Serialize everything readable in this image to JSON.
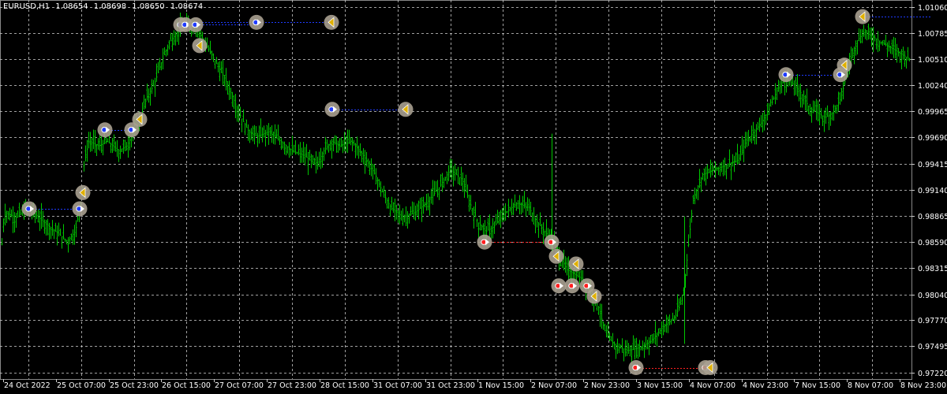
{
  "chart_data": {
    "type": "candlestick",
    "symbol": "EURUSD,H1",
    "ohlc": [
      "1.08654",
      "1.08698",
      "1.08650",
      "1.08674"
    ],
    "y_ticks": [
      "1.01060",
      "1.00785",
      "1.00510",
      "1.00240",
      "0.99965",
      "0.99690",
      "0.99415",
      "0.99140",
      "0.98865",
      "0.98590",
      "0.98315",
      "0.98040",
      "0.97770",
      "0.97495",
      "0.97220"
    ],
    "y_tick_values": [
      1.0106,
      1.00785,
      1.0051,
      1.0024,
      0.99965,
      0.9969,
      0.99415,
      0.9914,
      0.98865,
      0.9859,
      0.98315,
      0.9804,
      0.9777,
      0.97495,
      0.9722
    ],
    "x_ticks": [
      "24 Oct 2022",
      "25 Oct 07:00",
      "25 Oct 23:00",
      "26 Oct 15:00",
      "27 Oct 07:00",
      "27 Oct 23:00",
      "28 Oct 15:00",
      "31 Oct 07:00",
      "31 Oct 23:00",
      "1 Nov 15:00",
      "2 Nov 07:00",
      "2 Nov 23:00",
      "3 Nov 15:00",
      "4 Nov 07:00",
      "4 Nov 23:00",
      "7 Nov 15:00",
      "8 Nov 07:00",
      "8 Nov 23:00"
    ],
    "ylim": [
      0.9715,
      1.01135
    ],
    "grid": true,
    "close_path": [
      [
        0,
        0.9835
      ],
      [
        5,
        0.989
      ],
      [
        20,
        0.9885
      ],
      [
        35,
        0.9895
      ],
      [
        55,
        0.988
      ],
      [
        70,
        0.987
      ],
      [
        85,
        0.986
      ],
      [
        95,
        0.987
      ],
      [
        103,
        0.9905
      ],
      [
        106,
        0.994
      ],
      [
        112,
        0.9965
      ],
      [
        125,
        0.996
      ],
      [
        135,
        0.9965
      ],
      [
        150,
        0.9955
      ],
      [
        160,
        0.996
      ],
      [
        170,
        0.9975
      ],
      [
        178,
        0.999
      ],
      [
        185,
        1.001
      ],
      [
        195,
        1.0025
      ],
      [
        205,
        1.005
      ],
      [
        215,
        1.007
      ],
      [
        230,
        1.0085
      ],
      [
        245,
        1.0088
      ],
      [
        255,
        1.0075
      ],
      [
        265,
        1.006
      ],
      [
        275,
        1.0045
      ],
      [
        285,
        1.003
      ],
      [
        295,
        1.001
      ],
      [
        305,
        0.999
      ],
      [
        315,
        0.9975
      ],
      [
        325,
        0.997
      ],
      [
        340,
        0.9975
      ],
      [
        355,
        0.9965
      ],
      [
        370,
        0.9955
      ],
      [
        385,
        0.995
      ],
      [
        400,
        0.994
      ],
      [
        410,
        0.9955
      ],
      [
        420,
        0.9965
      ],
      [
        430,
        0.996
      ],
      [
        445,
        0.9965
      ],
      [
        460,
        0.995
      ],
      [
        475,
        0.993
      ],
      [
        485,
        0.991
      ],
      [
        495,
        0.9895
      ],
      [
        510,
        0.9885
      ],
      [
        525,
        0.989
      ],
      [
        540,
        0.99
      ],
      [
        555,
        0.9915
      ],
      [
        570,
        0.9935
      ],
      [
        585,
        0.9925
      ],
      [
        595,
        0.99
      ],
      [
        605,
        0.988
      ],
      [
        615,
        0.987
      ],
      [
        625,
        0.9875
      ],
      [
        640,
        0.989
      ],
      [
        655,
        0.99
      ],
      [
        670,
        0.9895
      ],
      [
        680,
        0.988
      ],
      [
        690,
        0.987
      ],
      [
        700,
        0.986
      ],
      [
        708,
        0.9845
      ],
      [
        718,
        0.983
      ],
      [
        728,
        0.9825
      ],
      [
        738,
        0.982
      ],
      [
        748,
        0.981
      ],
      [
        758,
        0.979
      ],
      [
        768,
        0.976
      ],
      [
        780,
        0.975
      ],
      [
        795,
        0.9745
      ],
      [
        810,
        0.9748
      ],
      [
        825,
        0.9755
      ],
      [
        840,
        0.977
      ],
      [
        855,
        0.978
      ],
      [
        865,
        0.98
      ],
      [
        870,
        0.984
      ],
      [
        878,
        0.9905
      ],
      [
        890,
        0.993
      ],
      [
        905,
        0.9935
      ],
      [
        920,
        0.994
      ],
      [
        935,
        0.9945
      ],
      [
        945,
        0.9965
      ],
      [
        955,
        0.9975
      ],
      [
        965,
        0.9985
      ],
      [
        975,
        1.0
      ],
      [
        985,
        1.002
      ],
      [
        995,
        1.003
      ],
      [
        1005,
        1.0025
      ],
      [
        1015,
        1.0015
      ],
      [
        1025,
        1.0
      ],
      [
        1035,
        0.9995
      ],
      [
        1045,
        0.999
      ],
      [
        1055,
        0.9995
      ],
      [
        1065,
        1.001
      ],
      [
        1075,
        1.0045
      ],
      [
        1085,
        1.007
      ],
      [
        1095,
        1.008
      ],
      [
        1105,
        1.0075
      ],
      [
        1115,
        1.007
      ],
      [
        1125,
        1.0065
      ],
      [
        1135,
        1.006
      ],
      [
        1145,
        1.0055
      ],
      [
        1155,
        1.005
      ]
    ],
    "trades": [
      {
        "x1": 37,
        "x2": 101,
        "p": 0.9894,
        "color": "#1f3bff",
        "dir": "buy"
      },
      {
        "x1": 133,
        "x2": 167,
        "p": 0.9977,
        "color": "#1f3bff",
        "dir": "buy"
      },
      {
        "x1": 229,
        "x2": 325,
        "p": 1.00875,
        "color": "#1f3bff",
        "dir": "buy"
      },
      {
        "x1": 248,
        "x2": 420,
        "p": 1.009,
        "color": "#1f3bff",
        "dir": "buy"
      },
      {
        "x1": 421,
        "x2": 514,
        "p": 0.99985,
        "color": "#1f3bff",
        "dir": "buy"
      },
      {
        "x1": 614,
        "x2": 699,
        "p": 0.9859,
        "color": "#ff2020",
        "dir": "sell"
      },
      {
        "x1": 708,
        "x2": 744,
        "p": 0.9813,
        "color": "#ff2020",
        "dir": "sell"
      },
      {
        "x1": 806,
        "x2": 900,
        "p": 0.9727,
        "color": "#ff2020",
        "dir": "sell"
      },
      {
        "x1": 996,
        "x2": 1065,
        "p": 1.0035,
        "color": "#1f3bff",
        "dir": "buy"
      },
      {
        "x1": 1093,
        "x2": 1180,
        "p": 1.0096,
        "color": "#1f3bff",
        "dir": "buy"
      }
    ],
    "markers": [
      {
        "x": 37,
        "p": 0.9894,
        "kind": "open-buy"
      },
      {
        "x": 101,
        "p": 0.9894,
        "kind": "open-buy"
      },
      {
        "x": 105,
        "p": 0.9911,
        "kind": "close"
      },
      {
        "x": 133,
        "p": 0.9977,
        "kind": "open-buy"
      },
      {
        "x": 167,
        "p": 0.9977,
        "kind": "open-buy"
      },
      {
        "x": 177,
        "p": 0.9988,
        "kind": "close"
      },
      {
        "x": 229,
        "p": 1.00875,
        "kind": "open-buy"
      },
      {
        "x": 235,
        "p": 1.00875,
        "kind": "open-buy"
      },
      {
        "x": 248,
        "p": 1.00875,
        "kind": "open-buy"
      },
      {
        "x": 253,
        "p": 1.00655,
        "kind": "close"
      },
      {
        "x": 325,
        "p": 1.009,
        "kind": "open-buy"
      },
      {
        "x": 420,
        "p": 1.009,
        "kind": "close"
      },
      {
        "x": 421,
        "p": 0.99985,
        "kind": "open-buy"
      },
      {
        "x": 514,
        "p": 0.99985,
        "kind": "close"
      },
      {
        "x": 614,
        "p": 0.9859,
        "kind": "open-sell"
      },
      {
        "x": 699,
        "p": 0.9859,
        "kind": "open-sell"
      },
      {
        "x": 705,
        "p": 0.9844,
        "kind": "close"
      },
      {
        "x": 730,
        "p": 0.9836,
        "kind": "close"
      },
      {
        "x": 708,
        "p": 0.9813,
        "kind": "open-sell"
      },
      {
        "x": 725,
        "p": 0.9813,
        "kind": "open-sell"
      },
      {
        "x": 744,
        "p": 0.9813,
        "kind": "open-sell"
      },
      {
        "x": 753,
        "p": 0.9802,
        "kind": "close"
      },
      {
        "x": 806,
        "p": 0.9727,
        "kind": "open-sell"
      },
      {
        "x": 894,
        "p": 0.9727,
        "kind": "open-sell"
      },
      {
        "x": 900,
        "p": 0.9727,
        "kind": "close"
      },
      {
        "x": 996,
        "p": 1.0035,
        "kind": "open-buy"
      },
      {
        "x": 1065,
        "p": 1.0035,
        "kind": "open-buy"
      },
      {
        "x": 1070,
        "p": 1.0045,
        "kind": "close"
      },
      {
        "x": 1093,
        "p": 1.0096,
        "kind": "close"
      }
    ],
    "colors": {
      "background": "#000000",
      "grid": "#c8c8c8",
      "bar": "#00c800",
      "axis_text": "#ffffff",
      "marker_fill": "#a8a090",
      "buy_line": "#1f3bff",
      "sell_line": "#ff2020",
      "close_arrow": "#e0b000"
    }
  }
}
